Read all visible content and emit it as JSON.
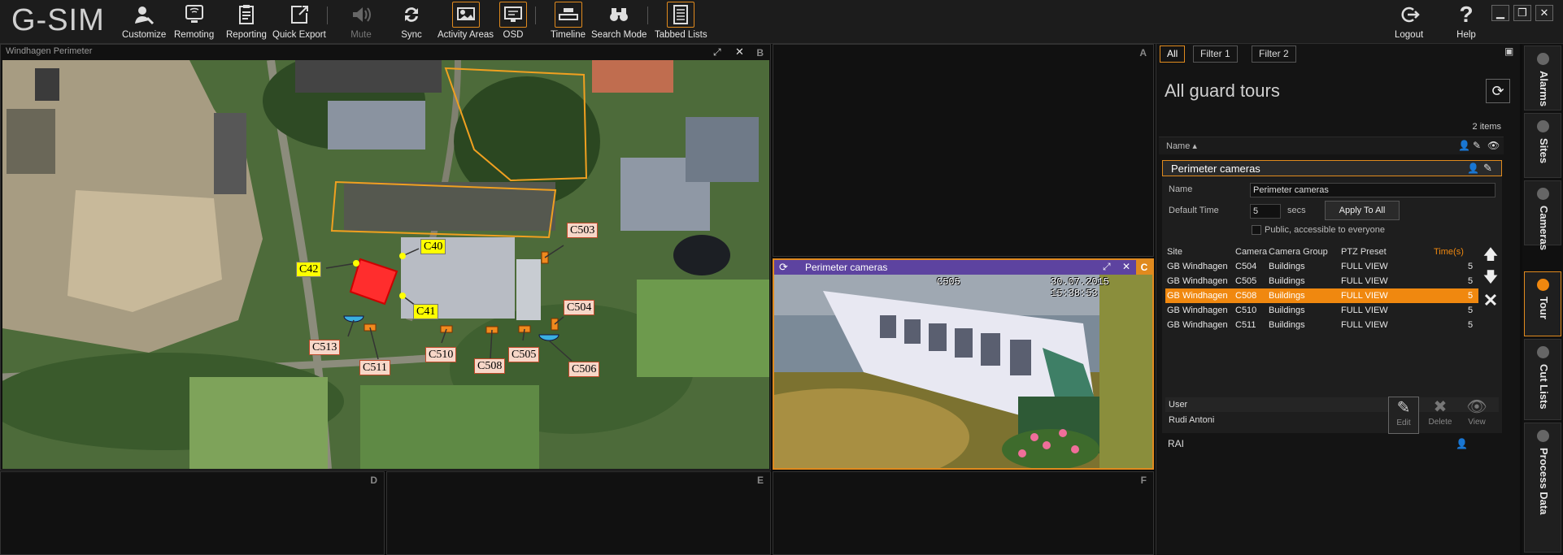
{
  "app": {
    "logo": "G-SIM"
  },
  "toolbar": {
    "buttons": [
      {
        "label": "Customize",
        "icon": "customize-icon"
      },
      {
        "label": "Remoting",
        "icon": "remoting-icon"
      },
      {
        "label": "Reporting",
        "icon": "reporting-icon"
      },
      {
        "label": "Quick Export",
        "icon": "export-icon"
      },
      {
        "label": "Mute",
        "icon": "speaker-icon"
      },
      {
        "label": "Sync",
        "icon": "sync-icon"
      },
      {
        "label": "Activity Areas",
        "icon": "activity-areas-icon"
      },
      {
        "label": "OSD",
        "icon": "monitor-icon"
      },
      {
        "label": "Timeline",
        "icon": "timeline-icon"
      },
      {
        "label": "Search Mode",
        "icon": "binoculars-icon"
      },
      {
        "label": "Tabbed Lists",
        "icon": "tabbed-lists-icon"
      }
    ],
    "logout": "Logout",
    "help": "Help",
    "help_glyph": "?"
  },
  "viewports": {
    "b": {
      "title": "Windhagen Perimeter",
      "letter": "B"
    },
    "a": {
      "letter": "A"
    },
    "c": {
      "title": "Perimeter cameras",
      "letter": "C",
      "osd_camera": "C505",
      "osd_time": "30.07.2015 15:38:53"
    },
    "d": {
      "letter": "D"
    },
    "e": {
      "letter": "E"
    },
    "f": {
      "letter": "F"
    }
  },
  "map": {
    "camera_labels": [
      "C503",
      "C504",
      "C513",
      "C511",
      "C510",
      "C508",
      "C505",
      "C506"
    ],
    "building_labels": [
      "C40",
      "C41",
      "C42"
    ]
  },
  "panel": {
    "filter_tabs": [
      "All",
      "Filter 1",
      "Filter 2"
    ],
    "heading": "All guard tours",
    "items_count": "2 items",
    "column_name": "Name ▴",
    "tour": {
      "name": "Perimeter cameras",
      "name_label": "Name",
      "name_value": "Perimeter cameras",
      "default_time_label": "Default Time",
      "default_time_value": "5",
      "secs": "secs",
      "apply_all": "Apply To All",
      "public_label": "Public, accessible to everyone",
      "table_headers": [
        "Site",
        "Camera",
        "Camera Group",
        "PTZ Preset",
        "Time(s)"
      ],
      "rows": [
        [
          "GB Windhagen",
          "C504",
          "Buildings",
          "FULL VIEW",
          "5"
        ],
        [
          "GB Windhagen",
          "C505",
          "Buildings",
          "FULL VIEW",
          "5"
        ],
        [
          "GB Windhagen",
          "C508",
          "Buildings",
          "FULL VIEW",
          "5"
        ],
        [
          "GB Windhagen",
          "C510",
          "Buildings",
          "FULL VIEW",
          "5"
        ],
        [
          "GB Windhagen",
          "C511",
          "Buildings",
          "FULL VIEW",
          "5"
        ]
      ],
      "selected_row": 2,
      "user_label": "User",
      "user_value": "Rudi Antoni"
    },
    "actions": [
      "Edit",
      "Delete",
      "View"
    ],
    "second_tour": "RAI"
  },
  "side_tabs": [
    "Alarms",
    "Sites",
    "Cameras",
    "Tour",
    "Cut Lists",
    "Process Data"
  ],
  "colors": {
    "accent": "#f0880f",
    "video_bar": "#5d43a0",
    "background": "#0d0d0d"
  }
}
